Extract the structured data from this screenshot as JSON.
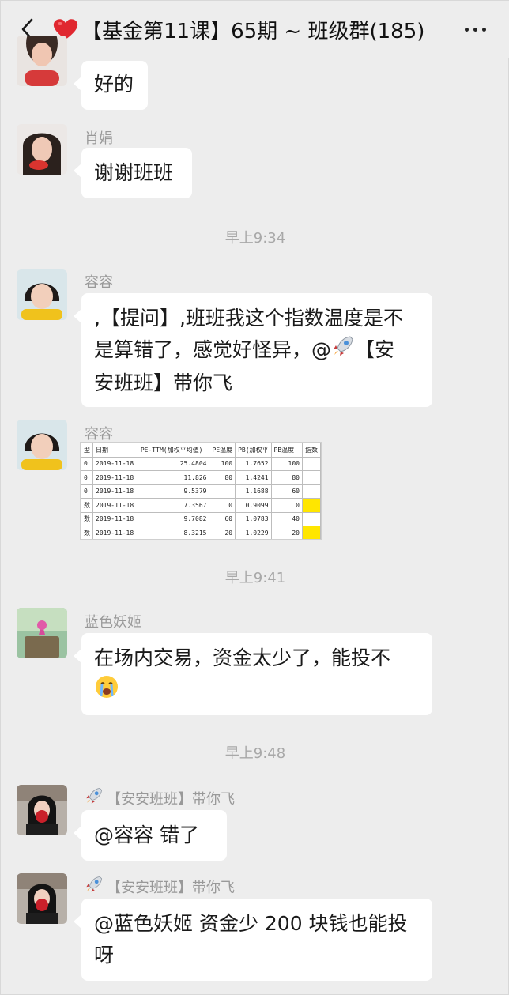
{
  "header": {
    "title": "【基金第11课】65期 ~ 班级群(185)",
    "back_icon": "chevron-left-icon",
    "heart_icon": "red-heart-icon",
    "more_icon": "more-dots-icon"
  },
  "messages": [
    {
      "sender": "",
      "text": "好的"
    },
    {
      "sender": "肖娟",
      "text": "谢谢班班"
    },
    {
      "timestamp": "早上9:34"
    },
    {
      "sender": "容容",
      "lines": [
        ",【提问】,班班我这个指数温度是不",
        "是算错了，感觉好怪异，@",
        "安班班】带你飞"
      ],
      "line2_suffix": "【安"
    },
    {
      "sender": "容容",
      "type": "image-table"
    },
    {
      "timestamp": "早上9:41"
    },
    {
      "sender": "蓝色妖姬",
      "text_line1": "在场内交易，资金太少了，能投不"
    },
    {
      "timestamp": "早上9:48"
    },
    {
      "sender": "【安安班班】带你飞",
      "text": "@容容  错了"
    },
    {
      "sender": "【安安班班】带你飞",
      "text_line1": "@蓝色妖姬  资金少 200 块钱也能投",
      "text_line2": "呀"
    }
  ],
  "table": {
    "headers": [
      "型",
      "日期",
      "PE-TTM(加权平均值)",
      "PE温度",
      "PB(加权平",
      "PB温度",
      "指数"
    ],
    "rows": [
      [
        "0",
        "2019-11-18",
        "25.4804",
        "100",
        "1.7652",
        "100",
        ""
      ],
      [
        "0",
        "2019-11-18",
        "11.826",
        "80",
        "1.4241",
        "80",
        ""
      ],
      [
        "0",
        "2019-11-18",
        "9.5379",
        "",
        "1.1688",
        "60",
        ""
      ],
      [
        "数",
        "2019-11-18",
        "7.3567",
        "0",
        "0.9099",
        "0",
        ""
      ],
      [
        "数",
        "2019-11-18",
        "9.7082",
        "60",
        "1.0783",
        "40",
        ""
      ],
      [
        "数",
        "2019-11-18",
        "8.3215",
        "20",
        "1.0229",
        "20",
        ""
      ]
    ],
    "highlight_color": "#ffe600"
  },
  "colors": {
    "background": "#ededed",
    "bubble": "#ffffff",
    "meta_text": "#999999"
  }
}
